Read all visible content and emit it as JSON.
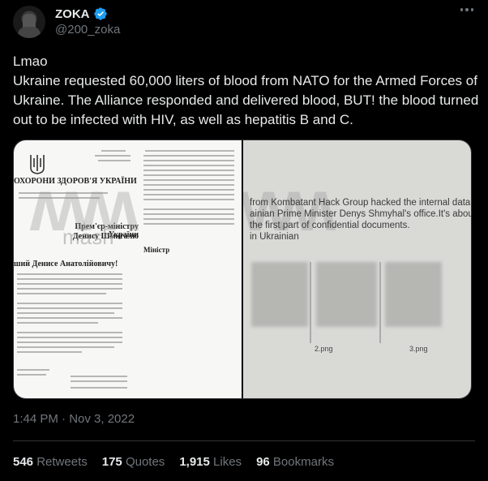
{
  "author": {
    "display_name": "ZOKA",
    "handle": "@200_zoka",
    "verified": true
  },
  "post": {
    "line1": "Lmao",
    "line2": "Ukraine requested 60,000 liters of blood from NATO for the Armed Forces of Ukraine. The Alliance responded and delivered blood, BUT! the blood turned out to be infected with HIV, as well as hepatitis B and C.",
    "timestamp": "1:44 PM · Nov 3, 2022"
  },
  "media": {
    "left_doc": {
      "heading": "ОХОРОНИ ЗДОРОВ'Я УКРАЇНИ",
      "addressee_1": "Прем'єр-міністру України",
      "addressee_2": "Денису Шмигалю",
      "greeting": "ший Денисе Анатолійовичу!",
      "signature": "Міністр",
      "watermark": "mash"
    },
    "right_screen": {
      "line1": "from Kombatant Hack Group hacked the internal data system",
      "line2": "ainian Prime Minister Denys Shmyhal's office.It's about Russian-",
      "line3": "the first part of confidential documents.",
      "line4": "in Ukrainian",
      "thumb1": "2.png",
      "thumb2": "3.png"
    }
  },
  "stats": {
    "retweets_num": "546",
    "retweets_lbl": "Retweets",
    "quotes_num": "175",
    "quotes_lbl": "Quotes",
    "likes_num": "1,915",
    "likes_lbl": "Likes",
    "bookmarks_num": "96",
    "bookmarks_lbl": "Bookmarks"
  },
  "colors": {
    "background": "#000000",
    "text": "#e7e9ea",
    "muted": "#71767b",
    "verified": "#1d9bf0"
  },
  "icons": [
    "verified-badge-icon",
    "more-options-icon"
  ]
}
